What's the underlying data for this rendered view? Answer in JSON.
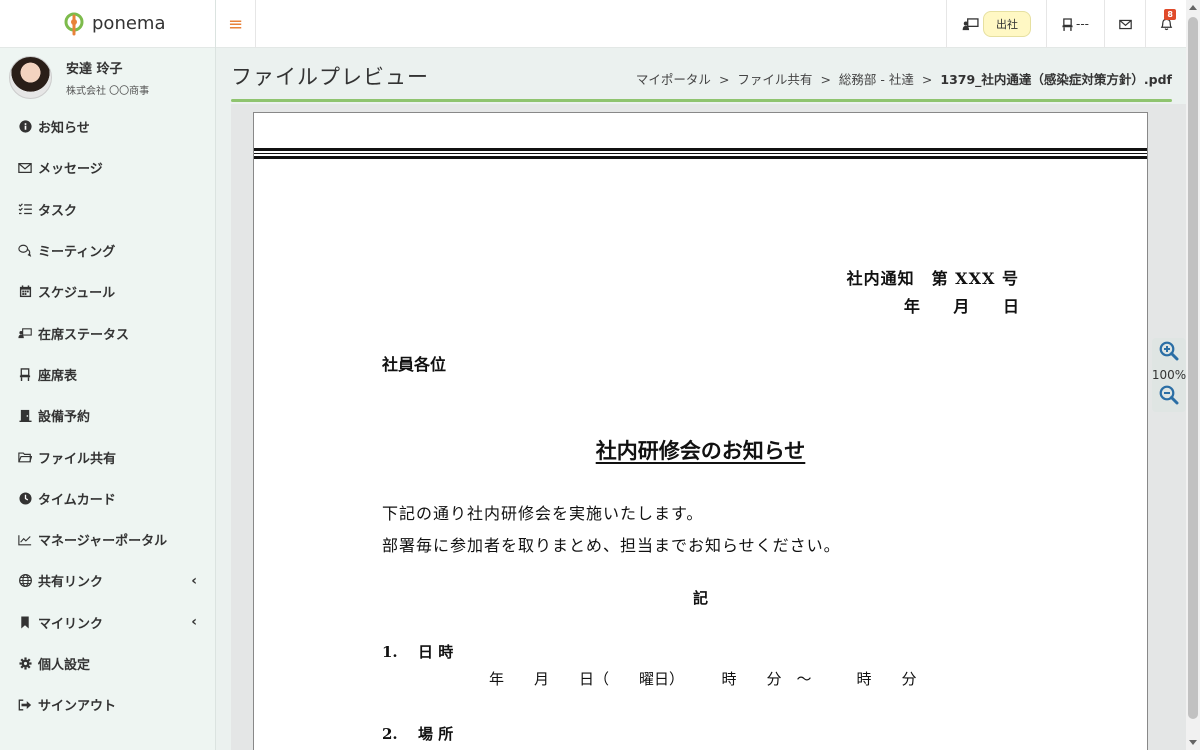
{
  "brand": {
    "name": "ponema"
  },
  "user": {
    "name": "安達 玲子",
    "company": "株式会社 〇〇商事"
  },
  "menu": [
    {
      "label": "お知らせ",
      "icon": "info-icon"
    },
    {
      "label": "メッセージ",
      "icon": "envelope-icon"
    },
    {
      "label": "タスク",
      "icon": "checklist-icon"
    },
    {
      "label": "ミーティング",
      "icon": "chat-bubbles-icon"
    },
    {
      "label": "スケジュール",
      "icon": "calendar-icon"
    },
    {
      "label": "在席ステータス",
      "icon": "presence-icon"
    },
    {
      "label": "座席表",
      "icon": "seat-icon"
    },
    {
      "label": "設備予約",
      "icon": "door-icon"
    },
    {
      "label": "ファイル共有",
      "icon": "folder-icon"
    },
    {
      "label": "タイムカード",
      "icon": "clock-icon"
    },
    {
      "label": "マネージャーポータル",
      "icon": "chart-line-icon"
    },
    {
      "label": "共有リンク",
      "icon": "globe-icon"
    },
    {
      "label": "マイリンク",
      "icon": "bookmark-icon"
    },
    {
      "label": "個人設定",
      "icon": "gear-icon"
    },
    {
      "label": "サインアウト",
      "icon": "sign-out-icon"
    }
  ],
  "topbar": {
    "status_label": "出社",
    "seat_label": "---",
    "notification_count": "8"
  },
  "page": {
    "title": "ファイルプレビュー",
    "breadcrumb": [
      "マイポータル",
      "ファイル共有",
      "総務部 - 社達"
    ],
    "breadcrumb_sep": ">",
    "breadcrumb_current": "1379_社内通達（感染症対策方針）.pdf"
  },
  "document": {
    "notice_no": "社内通知　第 XXX 号",
    "date_line": "年 月 日",
    "addressee": "社員各位",
    "title": "社内研修会のお知らせ",
    "body_line1": "下記の通り社内研修会を実施いたします。",
    "body_line2": "部署毎に参加者を取りまとめ、担当までお知らせください。",
    "ki": "記",
    "item1_num": "1.",
    "item1_label": "日 時",
    "item1_detail": "年　　月　　日（　　曜日）　　　時　　分　～　　　時　　分",
    "item2_num": "2.",
    "item2_label": "場 所"
  },
  "zoom": {
    "level": "100%"
  },
  "colors": {
    "accent_green": "#8fc46f",
    "hamburger_orange": "#e8823a",
    "status_yellow": "#fff8c4",
    "badge_red": "#e04a2a"
  }
}
